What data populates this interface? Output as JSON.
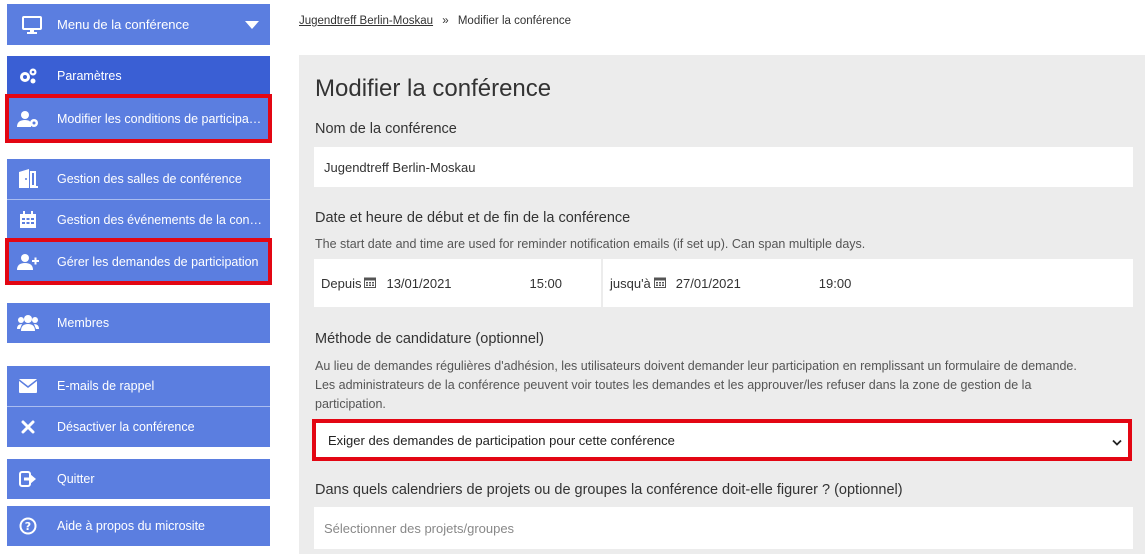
{
  "sidebar": {
    "menu_header": {
      "label": "Menu de la conférence",
      "icon": "monitor-icon"
    },
    "items": [
      {
        "label": "Paramètres",
        "icon": "gears-icon"
      },
      {
        "label": "Modifier les conditions de participation",
        "icon": "user-gear-icon"
      },
      {
        "label": "Gestion des salles de conférence",
        "icon": "door-icon"
      },
      {
        "label": "Gestion des événements de la confér...",
        "icon": "calendar-icon"
      },
      {
        "label": "Gérer les demandes de participation",
        "icon": "user-plus-icon"
      },
      {
        "label": "Membres",
        "icon": "users-icon"
      },
      {
        "label": "E-mails de rappel",
        "icon": "envelope-icon"
      },
      {
        "label": "Désactiver la conférence",
        "icon": "close-icon"
      },
      {
        "label": "Quitter",
        "icon": "sign-out-icon"
      },
      {
        "label": "Aide à propos du microsite",
        "icon": "question-icon"
      }
    ],
    "colors": {
      "item_bg": "#5b7ee0",
      "active_bg": "#3a5fd4",
      "highlight": "#e30613"
    }
  },
  "breadcrumb": {
    "link": "Jugendtreff Berlin-Moskau",
    "separator": "»",
    "current": "Modifier la conférence"
  },
  "form": {
    "title": "Modifier la conférence",
    "name_label": "Nom de la conférence",
    "name_value": "Jugendtreff Berlin-Moskau",
    "dates_label": "Date et heure de début et de fin de la conférence",
    "dates_help": "The start date and time are used for reminder notification emails (if set up). Can span multiple days.",
    "from_label": "Depuis",
    "from_date": "13/01/2021",
    "from_time": "15:00",
    "to_label": "jusqu'à",
    "to_date": "27/01/2021",
    "to_time": "19:00",
    "method_label": "Méthode de candidature (optionnel)",
    "method_help": "Au lieu de demandes régulières d'adhésion, les utilisateurs doivent demander leur participation en remplissant un formulaire de demande. Les administrateurs de la conférence peuvent voir toutes les demandes et les approuver/les refuser dans la zone de gestion de la participation.",
    "method_selected": "Exiger des demandes de participation pour cette conférence",
    "calendars_label": "Dans quels calendriers de projets ou de groupes la conférence doit-elle figurer ? (optionnel)",
    "calendars_placeholder": "Sélectionner des projets/groupes"
  }
}
